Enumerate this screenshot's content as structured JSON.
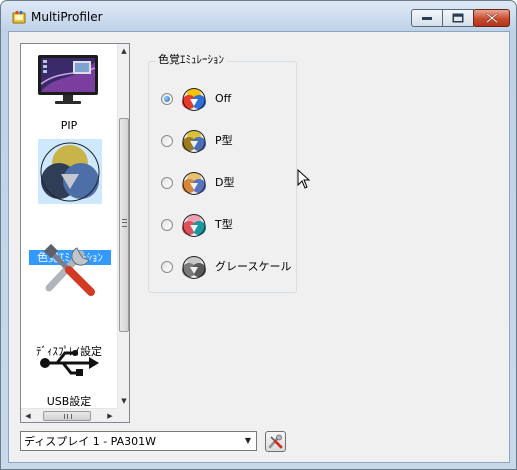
{
  "window": {
    "title": "MultiProfiler",
    "controls": {
      "minimize": "minimize",
      "maximize": "maximize",
      "close": "close"
    }
  },
  "sidebar": {
    "items": [
      {
        "label": "PIP",
        "icon": "monitor-icon"
      },
      {
        "label": "色覚ｴﾐｭﾚｰｼｮﾝ",
        "icon": "color-circles-icon",
        "selected": true
      },
      {
        "label": "ﾃﾞｨｽﾌﾟﾚｲ設定",
        "icon": "tools-icon"
      },
      {
        "label": "USB設定",
        "icon": "usb-icon"
      }
    ],
    "scrollbar_grip": "≡",
    "hscroll_grip": "III"
  },
  "emulation": {
    "group_title": "色覚ｴﾐｭﾚｰｼｮﾝ",
    "options": [
      {
        "label": "Off",
        "checked": true,
        "colors": [
          "#e83a2c",
          "#f5c400",
          "#2f6fd6"
        ]
      },
      {
        "label": "P型",
        "checked": false,
        "colors": [
          "#b08a2a",
          "#d9c23a",
          "#4a6fb8"
        ]
      },
      {
        "label": "D型",
        "checked": false,
        "colors": [
          "#d8873a",
          "#e8c26a",
          "#5a75c0"
        ]
      },
      {
        "label": "T型",
        "checked": false,
        "colors": [
          "#e0505a",
          "#f0a0b0",
          "#1a9aa0"
        ]
      },
      {
        "label": "グレースケール",
        "checked": false,
        "colors": [
          "#7a7a7a",
          "#c8c8c8",
          "#5a5a5a"
        ]
      }
    ]
  },
  "display_select": {
    "value": "ディスプレイ 1 - PA301W"
  }
}
